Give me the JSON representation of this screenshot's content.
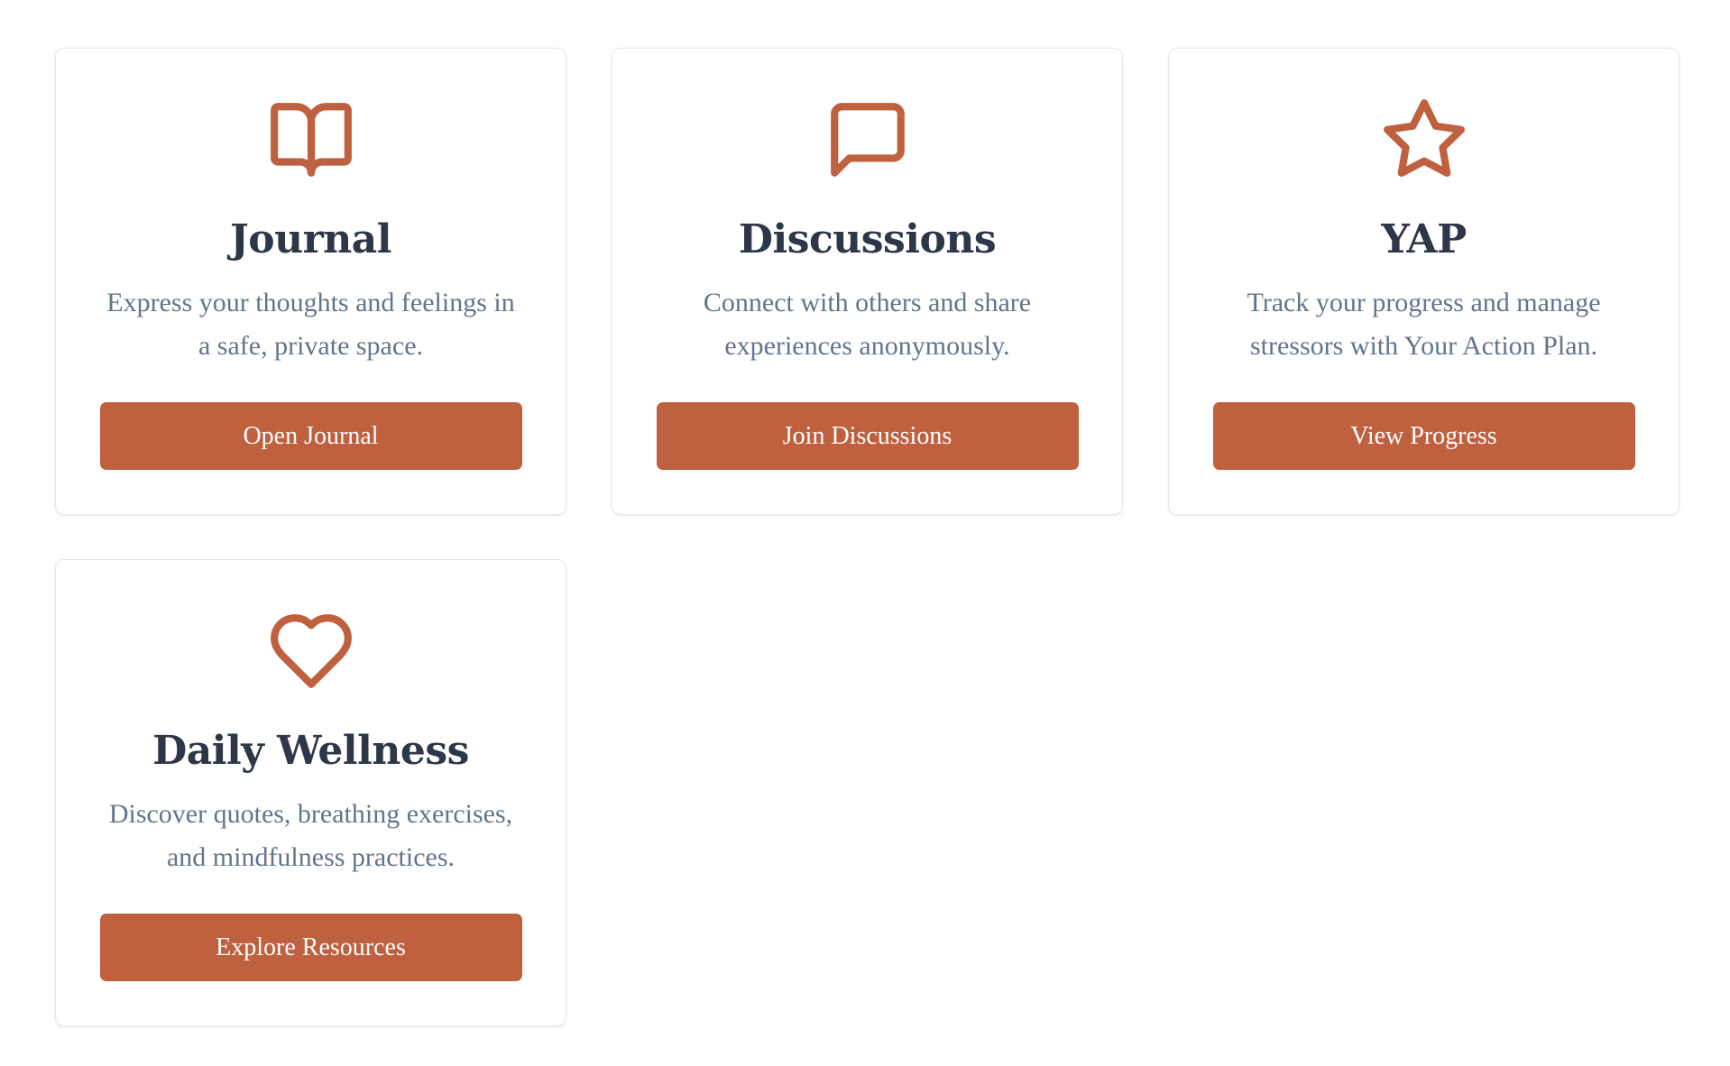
{
  "colors": {
    "accent": "#bf603e",
    "title": "#2d3748",
    "description": "#64748b",
    "card_border": "#e5e7eb"
  },
  "cards": [
    {
      "icon": "book-open-icon",
      "title": "Journal",
      "description": "Express your thoughts and feelings in a safe, private space.",
      "button_label": "Open Journal"
    },
    {
      "icon": "message-square-icon",
      "title": "Discussions",
      "description": "Connect with others and share experiences anonymously.",
      "button_label": "Join Discussions"
    },
    {
      "icon": "star-icon",
      "title": "YAP",
      "description": "Track your progress and manage stressors with Your Action Plan.",
      "button_label": "View Progress"
    },
    {
      "icon": "heart-icon",
      "title": "Daily Wellness",
      "description": "Discover quotes, breathing exercises, and mindfulness practices.",
      "button_label": "Explore Resources"
    }
  ]
}
